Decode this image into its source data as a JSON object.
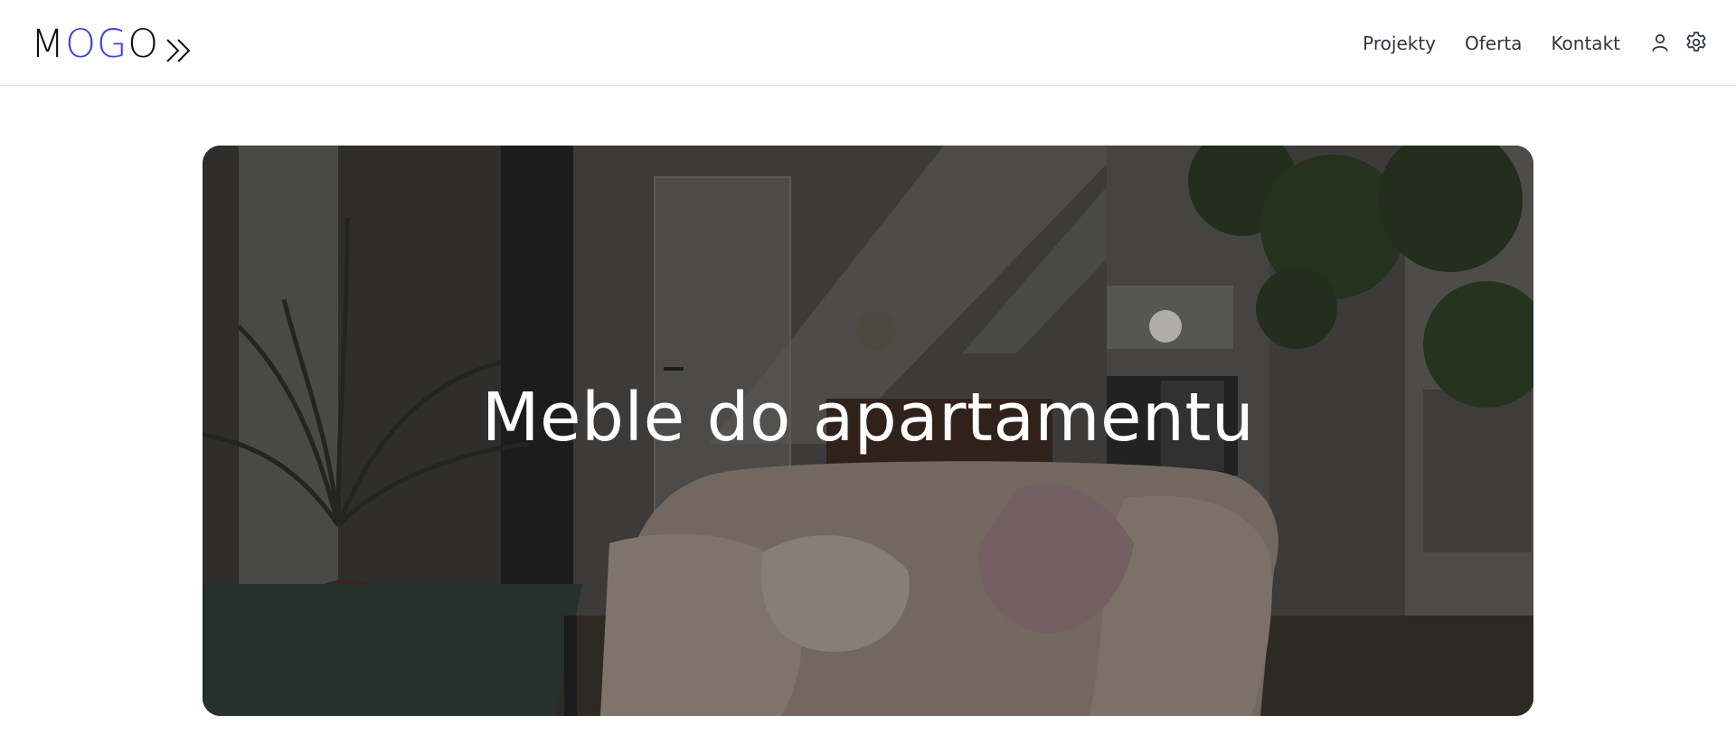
{
  "brand": {
    "logo_letters": [
      "M",
      "O",
      "G",
      "O"
    ],
    "logo_accent_color": "#3a3ff0",
    "logo_icon": "double-chevron-right-icon"
  },
  "nav": {
    "items": [
      {
        "label": "Projekty"
      },
      {
        "label": "Oferta"
      },
      {
        "label": "Kontakt"
      }
    ],
    "icons": [
      "user-icon",
      "gear-icon"
    ]
  },
  "hero": {
    "title": "Meble do apartamentu",
    "image": "living-room-with-sofa-and-plants"
  }
}
